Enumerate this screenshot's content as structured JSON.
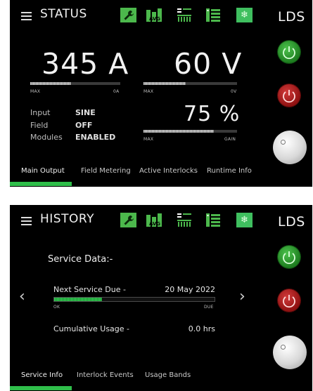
{
  "top": {
    "title": "STATUS",
    "brand": "LDS",
    "icons": [
      "wrench-icon",
      "avg-icon",
      "bar-meter-icon",
      "list-icon",
      "snowflake-icon"
    ],
    "avg_text": "AVG",
    "current": {
      "value": "345 A",
      "max_label": "MAX",
      "min_label": "0A",
      "level": 0.45
    },
    "voltage": {
      "value": "60 V",
      "max_label": "MAX",
      "min_label": "0V",
      "level": 0.45
    },
    "gain": {
      "value": "75 %",
      "max_label": "MAX",
      "min_label": "GAIN",
      "level": 0.75
    },
    "info": [
      {
        "label": "Input",
        "value": "SINE"
      },
      {
        "label": "Field",
        "value": "OFF"
      },
      {
        "label": "Modules",
        "value": "ENABLED"
      }
    ],
    "tabs": [
      "Main Output",
      "Field Metering",
      "Active Interlocks",
      "Runtime Info"
    ],
    "active_tab": "Main Output"
  },
  "bottom": {
    "title": "HISTORY",
    "brand": "LDS",
    "avg_text": "AVG",
    "section_title": "Service Data:-",
    "next_service": {
      "label": "Next Service Due -",
      "value": "20 May 2022",
      "ok_label": "OK",
      "due_label": "DUE",
      "level": 0.3
    },
    "usage": {
      "label": "Cumulative Usage -",
      "value": "0.0 hrs"
    },
    "tabs": [
      "Service Info",
      "Interlock Events",
      "Usage Bands"
    ],
    "active_tab": "Service Info"
  },
  "colors": {
    "accent_green": "#2fbe4a",
    "power_on": "#2e9e30",
    "power_off": "#b21b1b",
    "background": "#000000"
  }
}
